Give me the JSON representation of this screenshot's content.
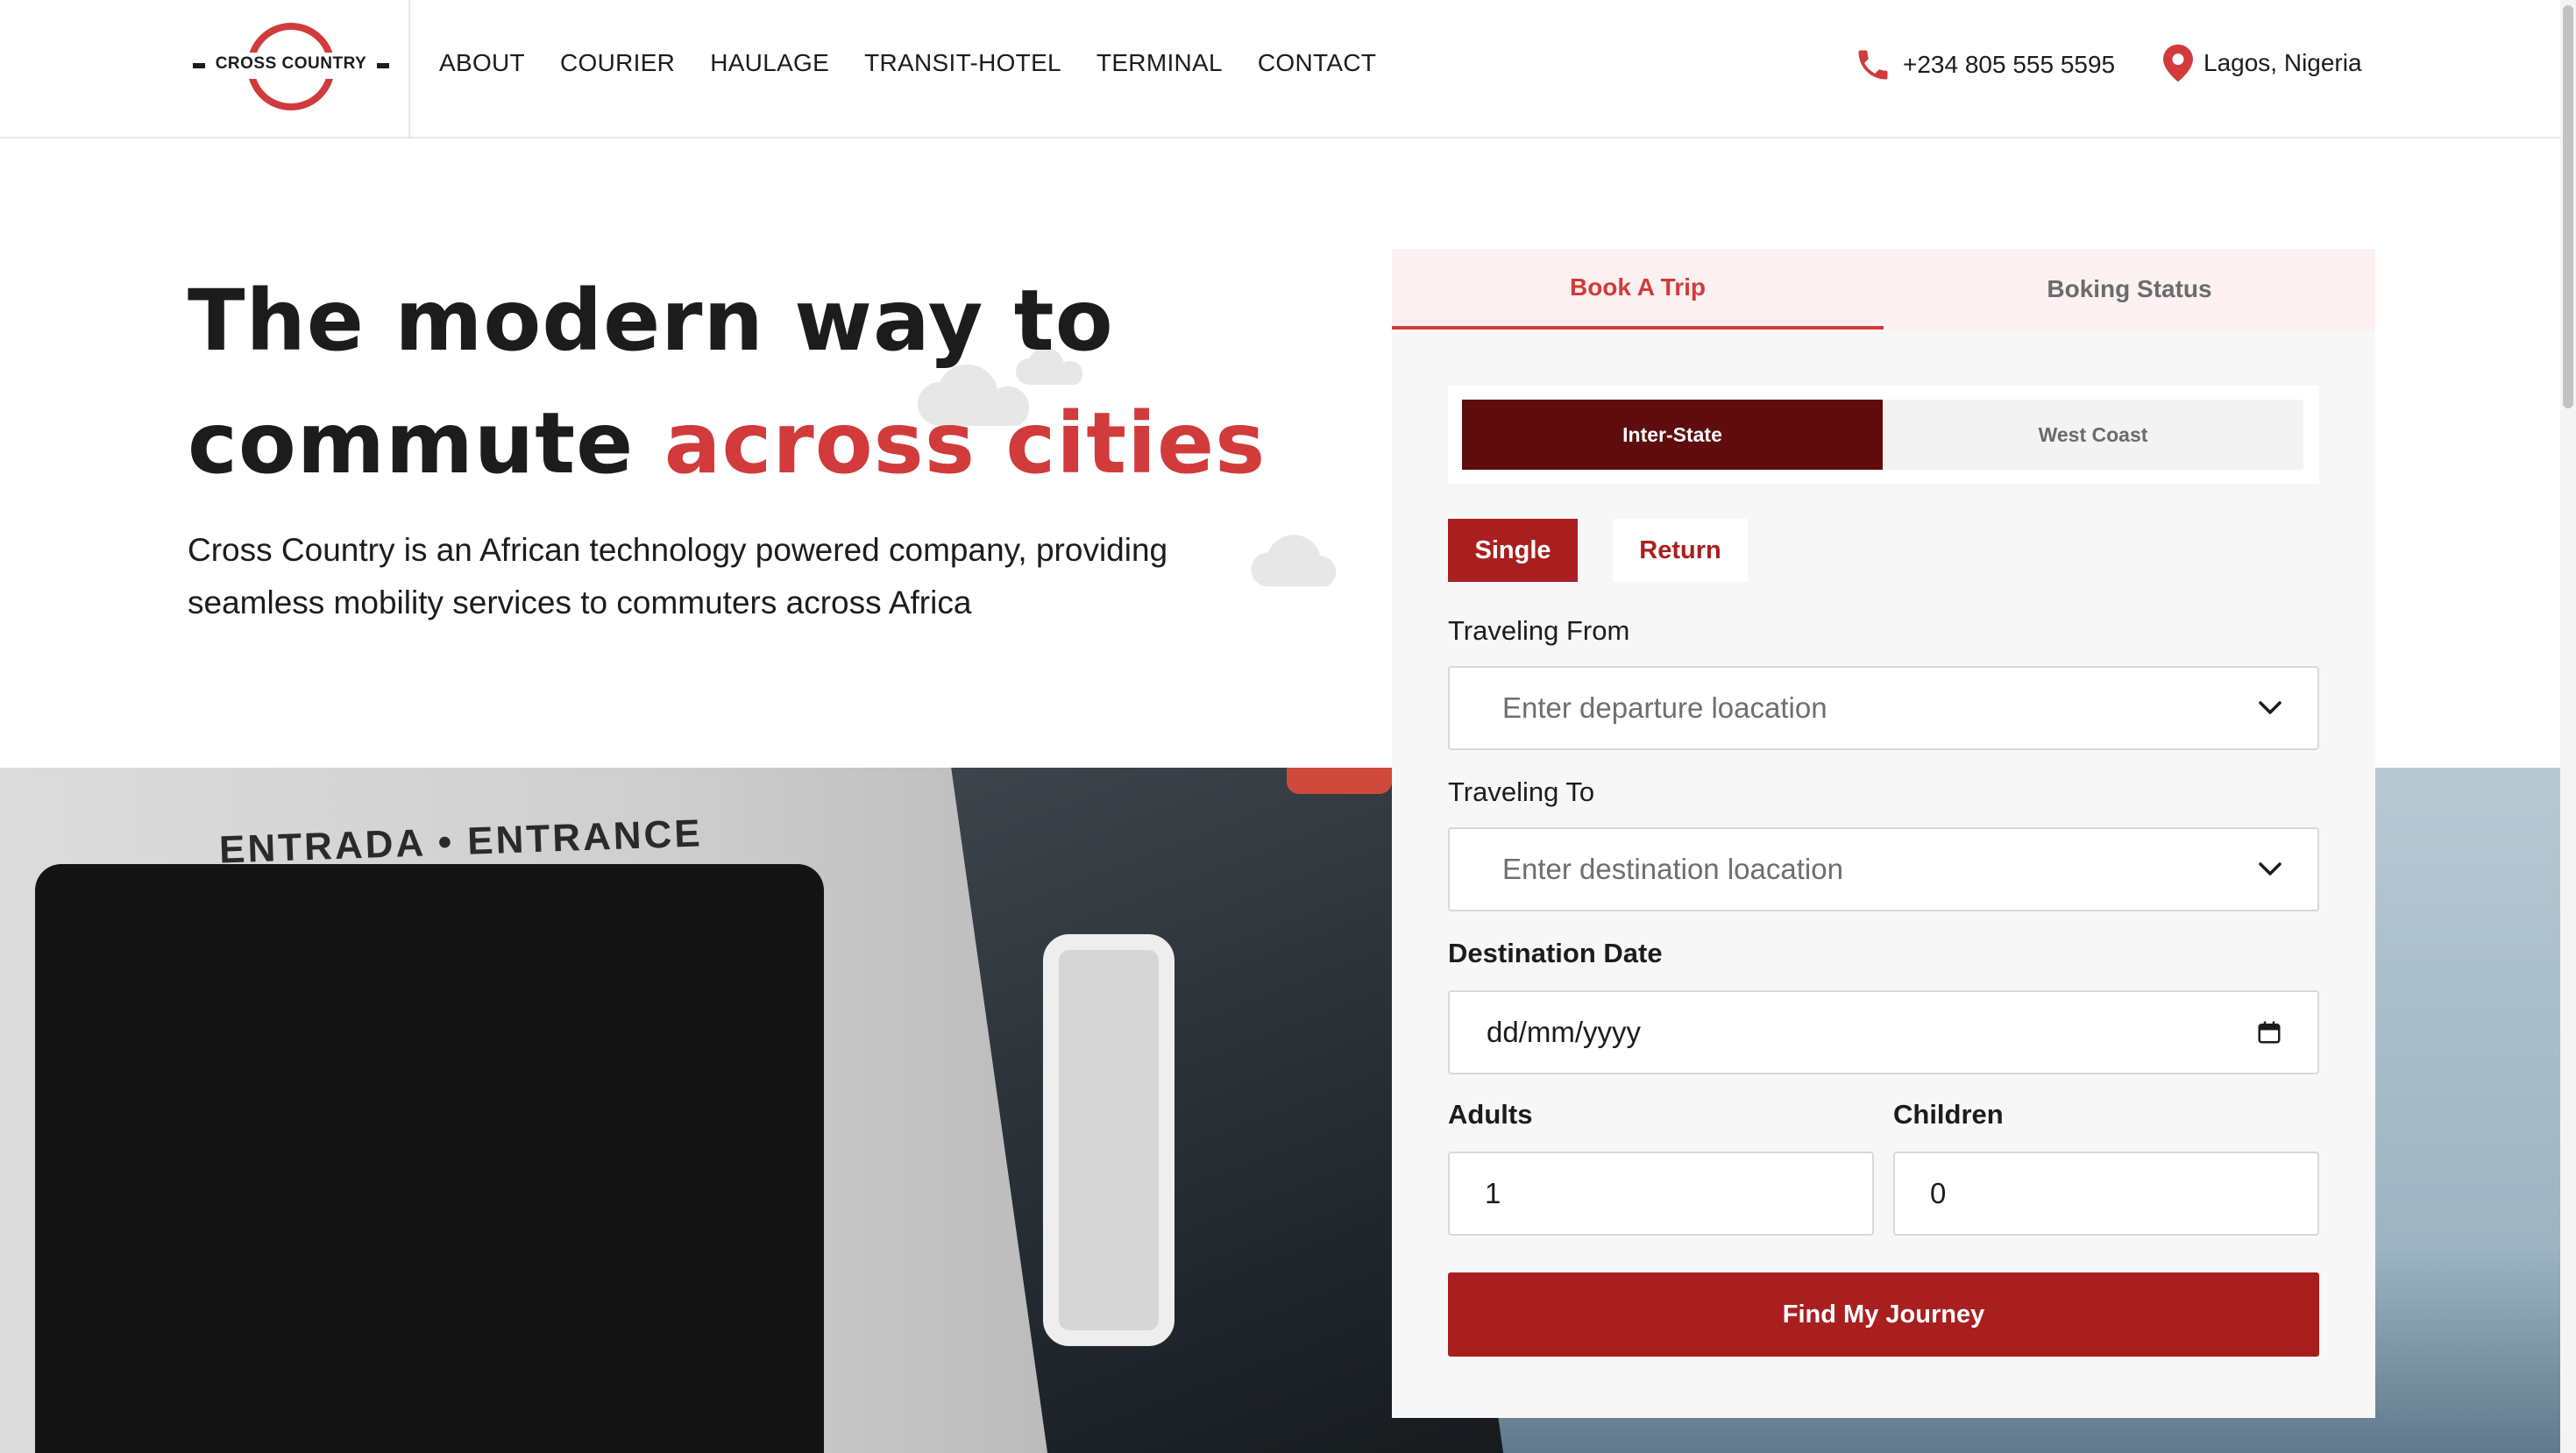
{
  "brand": {
    "name": "CROSS COUNTRY",
    "accent_color": "#d13b3b",
    "dark_red": "#a91f1f",
    "maroon": "#5e0c0c"
  },
  "nav": {
    "items": [
      {
        "label": "ABOUT"
      },
      {
        "label": "COURIER"
      },
      {
        "label": "HAULAGE"
      },
      {
        "label": "TRANSIT-HOTEL"
      },
      {
        "label": "TERMINAL"
      },
      {
        "label": "CONTACT"
      }
    ]
  },
  "contact": {
    "phone": "+234 805 555 5595",
    "phone_icon": "phone-icon",
    "location": "Lagos, Nigeria",
    "location_icon": "map-pin-icon"
  },
  "hero": {
    "title_line1": "The modern way to",
    "title_line2_plain": "commute ",
    "title_line2_accent": "across cities",
    "description": "Cross Country is an African technology powered company, providing seamless mobility services to commuters across Africa"
  },
  "photo": {
    "signage": "ENTRADA • ENTRANCE"
  },
  "booking": {
    "tabs": [
      {
        "label": "Book A Trip",
        "active": true
      },
      {
        "label": "Boking Status",
        "active": false
      }
    ],
    "route_types": [
      {
        "label": "Inter-State",
        "active": true
      },
      {
        "label": "West Coast",
        "active": false
      }
    ],
    "trip_types": [
      {
        "label": "Single",
        "active": true
      },
      {
        "label": "Return",
        "active": false
      }
    ],
    "from_label": "Traveling From",
    "from_placeholder": "Enter departure loacation",
    "to_label": "Traveling To",
    "to_placeholder": "Enter destination loacation",
    "date_label": "Destination Date",
    "date_value": "dd/mm/yyyy",
    "adults_label": "Adults",
    "adults_value": "1",
    "children_label": "Children",
    "children_value": "0",
    "submit_label": "Find My Journey"
  }
}
